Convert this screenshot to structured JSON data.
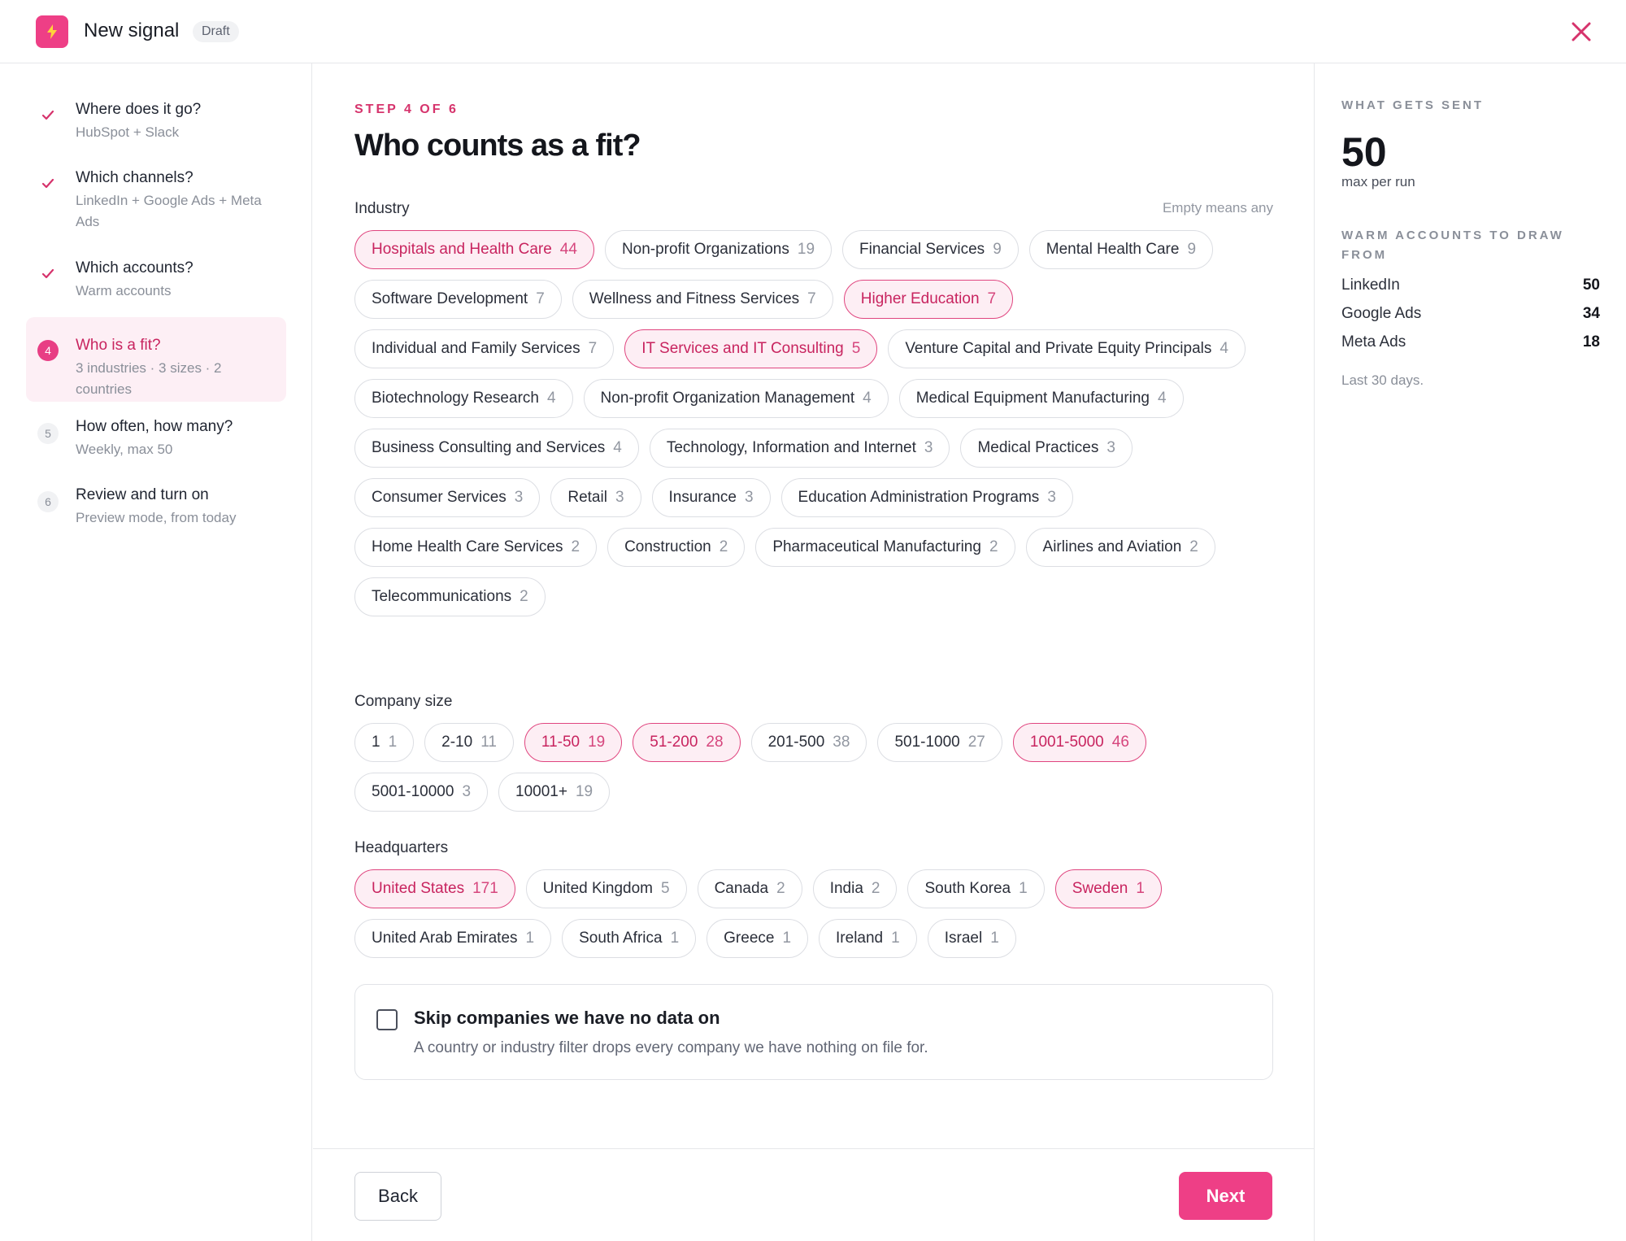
{
  "header": {
    "title": "New signal",
    "badge": "Draft",
    "colors": {
      "accent": "#ee3f86",
      "accent_text": "#d6336c"
    }
  },
  "steps": [
    {
      "title": "Where does it go?",
      "subtitle": "HubSpot + Slack",
      "state": "done"
    },
    {
      "title": "Which channels?",
      "subtitle": "LinkedIn + Google Ads + Meta Ads",
      "state": "done"
    },
    {
      "title": "Which accounts?",
      "subtitle": "Warm accounts",
      "state": "done"
    },
    {
      "number": "4",
      "title": "Who is a fit?",
      "subtitle": "3 industries · 3 sizes · 2 countries",
      "state": "active"
    },
    {
      "number": "5",
      "title": "How often, how many?",
      "subtitle": "Weekly, max 50",
      "state": "upcoming"
    },
    {
      "number": "6",
      "title": "Review and turn on",
      "subtitle": "Preview mode, from today",
      "state": "upcoming"
    }
  ],
  "main": {
    "step_label": "STEP 4 OF 6",
    "title": "Who counts as a fit?",
    "industry": {
      "label": "Industry",
      "hint": "Empty means any",
      "chips": [
        {
          "label": "Hospitals and Health Care",
          "count": "44",
          "selected": true
        },
        {
          "label": "Non-profit Organizations",
          "count": "19",
          "selected": false
        },
        {
          "label": "Financial Services",
          "count": "9",
          "selected": false
        },
        {
          "label": "Mental Health Care",
          "count": "9",
          "selected": false
        },
        {
          "label": "Software Development",
          "count": "7",
          "selected": false
        },
        {
          "label": "Wellness and Fitness Services",
          "count": "7",
          "selected": false
        },
        {
          "label": "Higher Education",
          "count": "7",
          "selected": true
        },
        {
          "label": "Individual and Family Services",
          "count": "7",
          "selected": false
        },
        {
          "label": "IT Services and IT Consulting",
          "count": "5",
          "selected": true
        },
        {
          "label": "Venture Capital and Private Equity Principals",
          "count": "4",
          "selected": false
        },
        {
          "label": "Biotechnology Research",
          "count": "4",
          "selected": false
        },
        {
          "label": "Non-profit Organization Management",
          "count": "4",
          "selected": false
        },
        {
          "label": "Medical Equipment Manufacturing",
          "count": "4",
          "selected": false
        },
        {
          "label": "Business Consulting and Services",
          "count": "4",
          "selected": false
        },
        {
          "label": "Technology, Information and Internet",
          "count": "3",
          "selected": false
        },
        {
          "label": "Medical Practices",
          "count": "3",
          "selected": false
        },
        {
          "label": "Consumer Services",
          "count": "3",
          "selected": false
        },
        {
          "label": "Retail",
          "count": "3",
          "selected": false
        },
        {
          "label": "Insurance",
          "count": "3",
          "selected": false
        },
        {
          "label": "Education Administration Programs",
          "count": "3",
          "selected": false
        },
        {
          "label": "Home Health Care Services",
          "count": "2",
          "selected": false
        },
        {
          "label": "Construction",
          "count": "2",
          "selected": false
        },
        {
          "label": "Pharmaceutical Manufacturing",
          "count": "2",
          "selected": false
        },
        {
          "label": "Airlines and Aviation",
          "count": "2",
          "selected": false
        },
        {
          "label": "Telecommunications",
          "count": "2",
          "selected": false
        }
      ]
    },
    "company_size": {
      "label": "Company size",
      "chips": [
        {
          "label": "1",
          "count": "1",
          "selected": false
        },
        {
          "label": "2-10",
          "count": "11",
          "selected": false
        },
        {
          "label": "11-50",
          "count": "19",
          "selected": true
        },
        {
          "label": "51-200",
          "count": "28",
          "selected": true
        },
        {
          "label": "201-500",
          "count": "38",
          "selected": false
        },
        {
          "label": "501-1000",
          "count": "27",
          "selected": false
        },
        {
          "label": "1001-5000",
          "count": "46",
          "selected": true
        },
        {
          "label": "5001-10000",
          "count": "3",
          "selected": false
        },
        {
          "label": "10001+",
          "count": "19",
          "selected": false
        }
      ]
    },
    "headquarters": {
      "label": "Headquarters",
      "chips": [
        {
          "label": "United States",
          "count": "171",
          "selected": true
        },
        {
          "label": "United Kingdom",
          "count": "5",
          "selected": false
        },
        {
          "label": "Canada",
          "count": "2",
          "selected": false
        },
        {
          "label": "India",
          "count": "2",
          "selected": false
        },
        {
          "label": "South Korea",
          "count": "1",
          "selected": false
        },
        {
          "label": "Sweden",
          "count": "1",
          "selected": true
        },
        {
          "label": "United Arab Emirates",
          "count": "1",
          "selected": false
        },
        {
          "label": "South Africa",
          "count": "1",
          "selected": false
        },
        {
          "label": "Greece",
          "count": "1",
          "selected": false
        },
        {
          "label": "Ireland",
          "count": "1",
          "selected": false
        },
        {
          "label": "Israel",
          "count": "1",
          "selected": false
        }
      ]
    },
    "skip": {
      "title": "Skip companies we have no data on",
      "description": "A country or industry filter drops every company we have nothing on file for.",
      "checked": false
    }
  },
  "footer": {
    "back_label": "Back",
    "next_label": "Next"
  },
  "summary": {
    "label": "WHAT GETS SENT",
    "max_value": "50",
    "max_caption": "max per run",
    "warm_label": "WARM ACCOUNTS TO DRAW FROM",
    "channels": [
      {
        "name": "LinkedIn",
        "value": "50"
      },
      {
        "name": "Google Ads",
        "value": "34"
      },
      {
        "name": "Meta Ads",
        "value": "18"
      }
    ],
    "note": "Last 30 days."
  }
}
